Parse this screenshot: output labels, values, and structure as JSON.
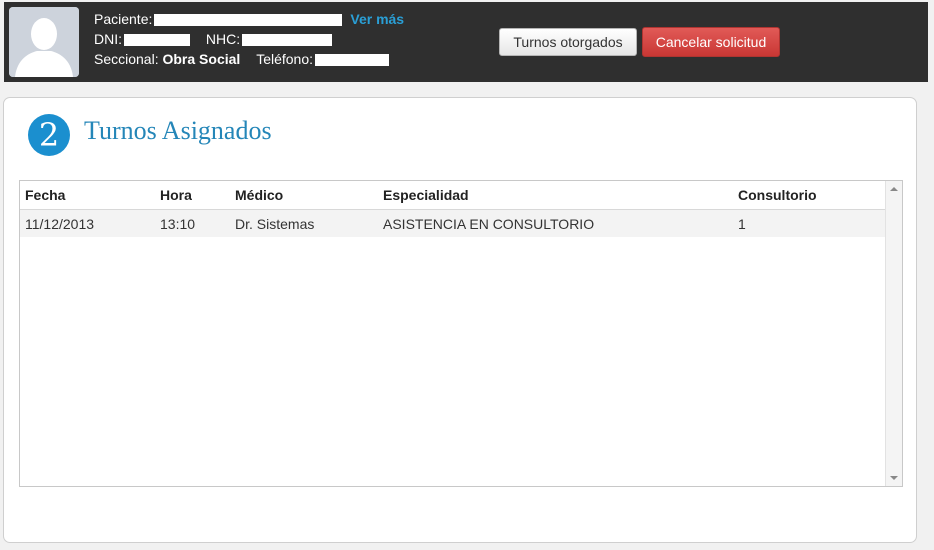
{
  "patient": {
    "paciente_label": "Paciente:",
    "ver_mas": "Ver más",
    "dni_label": "DNI:",
    "nhc_label": "NHC:",
    "seccional_label": "Seccional:",
    "seccional_value": "Obra Social",
    "telefono_label": "Teléfono:"
  },
  "actions": {
    "turnos_otorgados": "Turnos otorgados",
    "cancelar_solicitud": "Cancelar solicitud"
  },
  "panel": {
    "step": "2",
    "title": "Turnos Asignados"
  },
  "table": {
    "columns": [
      "Fecha",
      "Hora",
      "Médico",
      "Especialidad",
      "Consultorio"
    ],
    "rows": [
      [
        "11/12/2013",
        "13:10",
        "Dr. Sistemas",
        "ASISTENCIA EN CONSULTORIO",
        "1"
      ]
    ]
  },
  "colors": {
    "header_bg": "#2f2f2f",
    "accent": "#1b8fcf",
    "link": "#2a9fd6",
    "danger": "#d9534f"
  }
}
